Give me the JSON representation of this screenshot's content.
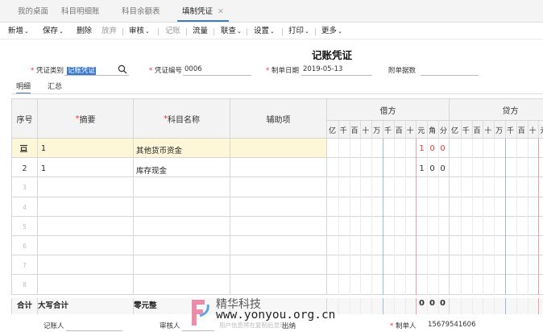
{
  "tabs": [
    {
      "label": "我的桌面"
    },
    {
      "label": "科目明细账"
    },
    {
      "label": "科目余额表"
    },
    {
      "label": "填制凭证",
      "close": "✕"
    }
  ],
  "toolbar": {
    "new": "新增",
    "save": "保存",
    "delete": "删除",
    "abandon": "放弃",
    "audit": "审核",
    "post": "记账",
    "cashflow": "流量",
    "link": "联查",
    "settings": "设置",
    "print": "打印",
    "more": "更多",
    "chevron": "⌄"
  },
  "voucher": {
    "title": "记账凭证",
    "type_label": "凭证类别",
    "type_value": "记账凭证",
    "number_label": "凭证编号",
    "number_value": "0006",
    "date_label": "制单日期",
    "date_value": "2019-05-13",
    "attach_label": "附单据数",
    "req_mark": "*"
  },
  "subtabs": {
    "detail": "明细",
    "summary": "汇总"
  },
  "grid": {
    "headers": {
      "seq": "序号",
      "summary": "摘要",
      "account": "科目名称",
      "aux": "辅助项",
      "debit": "借方",
      "credit": "贷方"
    },
    "units": [
      "亿",
      "千",
      "百",
      "十",
      "万",
      "千",
      "百",
      "十",
      "元",
      "角",
      "分"
    ],
    "credit_units": [
      "亿",
      "千",
      "百",
      "十",
      "万",
      "千",
      "百",
      "十",
      "元"
    ],
    "rows": [
      {
        "seq": "",
        "summary": "1",
        "account": "其他货币资金",
        "debit": [
          "1",
          "0",
          "0"
        ]
      },
      {
        "seq": "2",
        "summary": "1",
        "account": "库存现金",
        "debit": [
          "1",
          "0",
          "0"
        ]
      }
    ],
    "empty_rows": [
      "3",
      "4",
      "5",
      "6",
      "7",
      "8"
    ],
    "total": {
      "label": "合计",
      "big_label": "大写合计",
      "big_value": "零元整",
      "debit": [
        "0",
        "0",
        "0"
      ]
    }
  },
  "footer": {
    "bookkeeper": "记账人",
    "auditor": "审核人",
    "cashier": "出纳",
    "maker_label": "制单人",
    "maker_value": "15679541606",
    "maker_req": "*",
    "overlay_text": "用户信息将在复制后显示"
  },
  "watermark": {
    "cn": "精华科技",
    "url": "www.yonyou.org.cn"
  },
  "colors": {
    "accent": "#3d7ccc",
    "required": "#e33333",
    "selected_row": "#fdf7d8",
    "header_bg": "#f3f3f3"
  }
}
